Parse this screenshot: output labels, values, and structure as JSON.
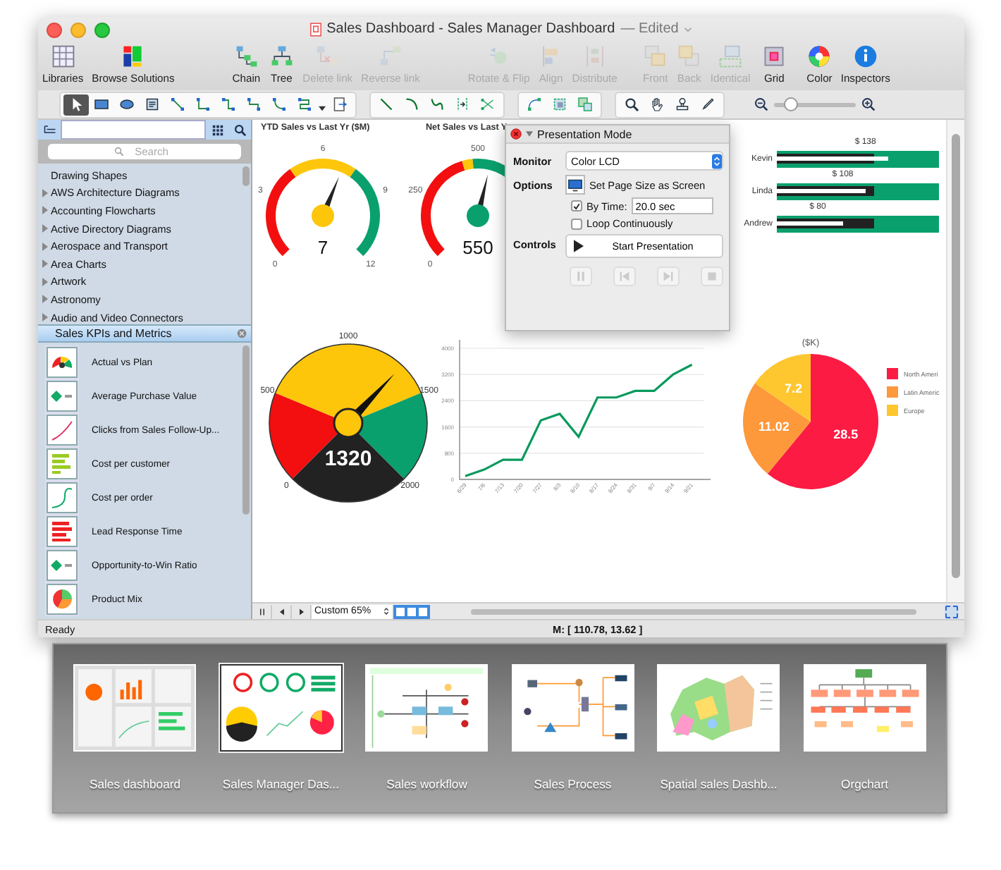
{
  "window": {
    "title": "Sales Dashboard - Sales Manager Dashboard",
    "status": "— Edited"
  },
  "toolbar": [
    [
      {
        "label": "Libraries",
        "disabled": false
      },
      {
        "label": "Browse Solutions",
        "disabled": false
      }
    ],
    [
      {
        "label": "Chain",
        "disabled": false
      },
      {
        "label": "Tree",
        "disabled": false
      },
      {
        "label": "Delete link",
        "disabled": true
      },
      {
        "label": "Reverse link",
        "disabled": true
      }
    ],
    [
      {
        "label": "Rotate & Flip",
        "disabled": true
      },
      {
        "label": "Align",
        "disabled": true
      },
      {
        "label": "Distribute",
        "disabled": true
      }
    ],
    [
      {
        "label": "Front",
        "disabled": true
      },
      {
        "label": "Back",
        "disabled": true
      },
      {
        "label": "Identical",
        "disabled": true
      }
    ],
    [
      {
        "label": "Grid",
        "disabled": false
      }
    ],
    [
      {
        "label": "Color",
        "disabled": false
      },
      {
        "label": "Inspectors",
        "disabled": false
      }
    ]
  ],
  "tool_groups": [
    [
      {
        "selected": true
      },
      {
        "selected": false
      },
      {
        "selected": false
      },
      {
        "selected": false
      },
      {
        "selected": false
      },
      {
        "selected": false
      },
      {
        "selected": false
      },
      {
        "selected": false
      },
      {
        "selected": false
      },
      {
        "selected": false
      },
      {
        "selected": false
      }
    ],
    [
      {
        "selected": false
      },
      {
        "selected": false
      },
      {
        "selected": false
      },
      {
        "selected": false
      },
      {
        "selected": false
      }
    ],
    [
      {
        "selected": false
      },
      {
        "selected": false
      },
      {
        "selected": false
      }
    ],
    [
      {
        "selected": false
      },
      {
        "selected": false
      },
      {
        "selected": false
      },
      {
        "selected": false
      }
    ]
  ],
  "zoom_slider": {
    "level": 0.2
  },
  "sidebar": {
    "search": {
      "placeholder": "Search"
    },
    "libraries": [
      {
        "label": "Drawing Shapes",
        "kind": "plain"
      },
      {
        "label": "AWS Architecture Diagrams",
        "kind": "folder"
      },
      {
        "label": "Accounting Flowcharts",
        "kind": "folder"
      },
      {
        "label": "Active Directory Diagrams",
        "kind": "folder"
      },
      {
        "label": "Aerospace and Transport",
        "kind": "folder"
      },
      {
        "label": "Area Charts",
        "kind": "folder"
      },
      {
        "label": "Artwork",
        "kind": "folder"
      },
      {
        "label": "Astronomy",
        "kind": "folder"
      },
      {
        "label": "Audio and Video Connectors",
        "kind": "folder"
      }
    ],
    "section": {
      "title": "Sales KPIs and Metrics",
      "items": [
        {
          "label": "Actual vs Plan",
          "kind": "gauge"
        },
        {
          "label": "Average Purchase Value",
          "kind": "diamond"
        },
        {
          "label": "Clicks from Sales Follow-Up...",
          "kind": "line"
        },
        {
          "label": "Cost per customer",
          "kind": "bars"
        },
        {
          "label": "Cost per order",
          "kind": "curve"
        },
        {
          "label": "Lead Response Time",
          "kind": "redbars"
        },
        {
          "label": "Opportunity-to-Win Ratio",
          "kind": "diamond"
        },
        {
          "label": "Product Mix",
          "kind": "pie"
        }
      ]
    }
  },
  "gauges": [
    {
      "title": "YTD Sales vs Last Yr ($M)",
      "ticks": [
        "0",
        "3",
        "6",
        "9",
        "12"
      ],
      "value": "7",
      "kind": "arc"
    },
    {
      "title": "Net Sales vs Last Y",
      "ticks": [
        "0",
        "250",
        "500"
      ],
      "value": "550",
      "kind": "arc"
    },
    {
      "ticks": [
        "0",
        "500",
        "1000",
        "1500",
        "2000"
      ],
      "value": "1320",
      "kind": "dial"
    }
  ],
  "bullets": [
    {
      "name": "Kevin",
      "amount": "$ 138",
      "level": 0.69
    },
    {
      "name": "Linda",
      "amount": "$ 108",
      "level": 0.55
    },
    {
      "name": "Andrew",
      "amount": "$ 80",
      "level": 0.41
    }
  ],
  "line_chart": {
    "chart_data": {
      "type": "line",
      "categories": [
        "6/29",
        "7/6",
        "7/13",
        "7/20",
        "7/27",
        "8/3",
        "8/10",
        "8/17",
        "8/24",
        "8/31",
        "9/7",
        "9/14",
        "9/21"
      ],
      "values": [
        100,
        300,
        600,
        600,
        1800,
        2000,
        1300,
        2500,
        2500,
        2700,
        2700,
        3200,
        3500
      ],
      "ylim": [
        0,
        4000
      ],
      "yticks": [
        0,
        800,
        1600,
        2400,
        3200,
        4000
      ],
      "grid": true
    }
  },
  "pie_chart": {
    "chart_data": {
      "type": "pie",
      "title": "($K)",
      "categories": [
        "North Ameri",
        "Latin Americ",
        "Europe"
      ],
      "values": [
        28.5,
        11.02,
        7.2
      ],
      "legend": "right",
      "colors": [
        "#fb1b43",
        "#fd983b",
        "#fec62f"
      ],
      "value_labels": [
        "28.5",
        "11.02",
        "7.2"
      ]
    }
  },
  "presentation": {
    "title": "Presentation Mode",
    "monitor_label": "Monitor",
    "monitor": "Color LCD",
    "options_label": "Options",
    "page_size": "Set Page Size as Screen",
    "by_time": {
      "label": "By Time:",
      "checked": true,
      "value": "20.0 sec"
    },
    "loop": {
      "label": "Loop Continuously",
      "checked": false
    },
    "controls_label": "Controls",
    "start": "Start Presentation"
  },
  "bottom_bar": {
    "zoom": "Custom 65%"
  },
  "status_bar": {
    "left": "Ready",
    "coordinates": "M: [ 110.78, 13.62 ]"
  },
  "solutions": [
    {
      "label": "Sales dashboard",
      "selected": false
    },
    {
      "label": "Sales Manager Das...",
      "selected": true
    },
    {
      "label": "Sales workflow",
      "selected": false
    },
    {
      "label": "Sales Process",
      "selected": false
    },
    {
      "label": "Spatial sales Dashb...",
      "selected": false
    },
    {
      "label": "Orgchart",
      "selected": false
    }
  ]
}
